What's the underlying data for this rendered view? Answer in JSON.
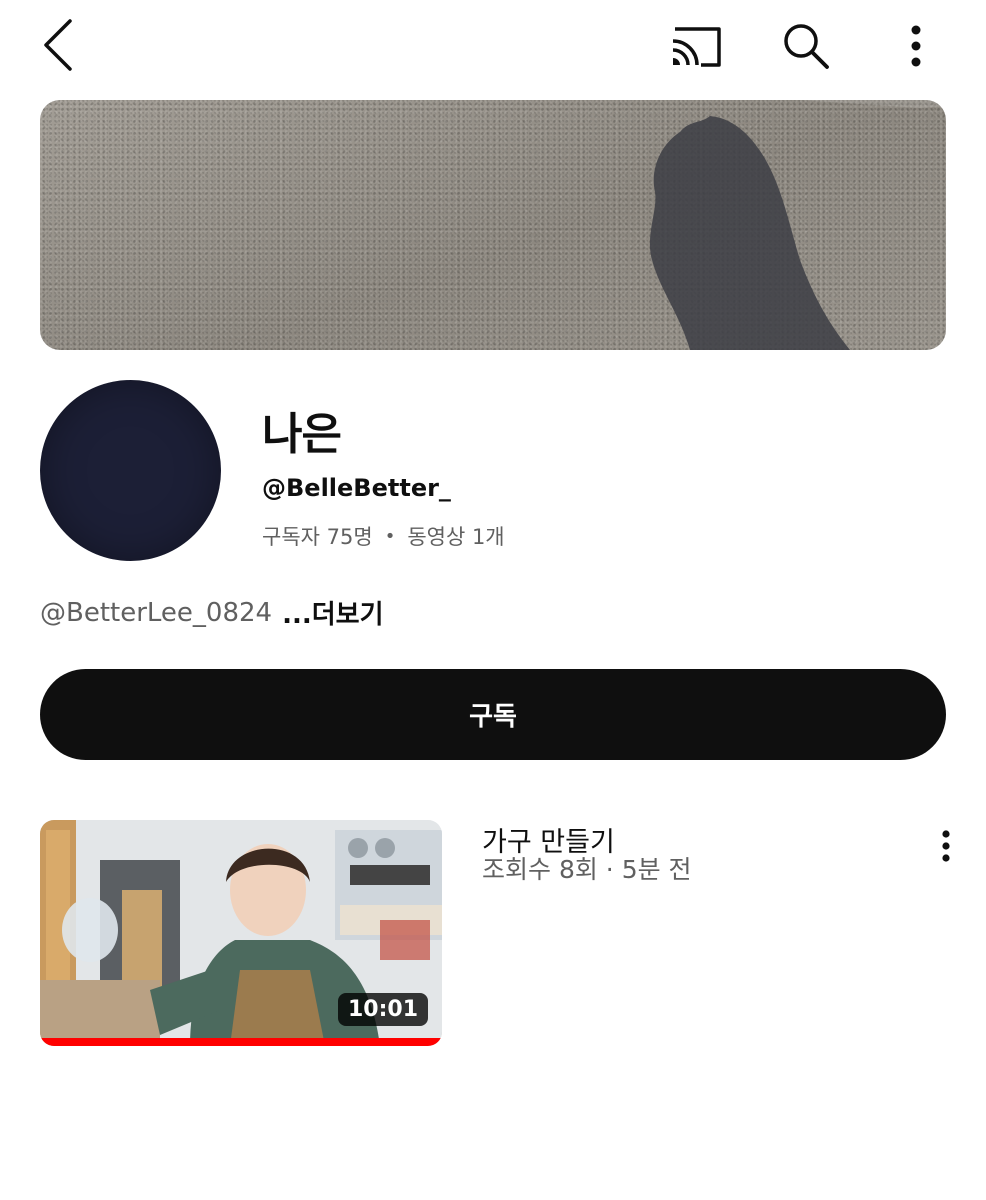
{
  "header": {
    "back_icon": "chevron-left-icon",
    "cast_icon": "cast-icon",
    "search_icon": "search-icon",
    "more_icon": "more-vertical-icon"
  },
  "channel": {
    "name": "나은",
    "handle": "@BelleBetter_",
    "subscribers": "구독자 75명",
    "separator": "•",
    "videos": "동영상 1개",
    "description": "@BetterLee_0824",
    "more_label": "...더보기",
    "subscribe_label": "구독"
  },
  "videos": [
    {
      "title": "가구 만들기",
      "meta": "조회수 8회 · 5분 전",
      "duration": "10:01",
      "watched_fraction": 1.0
    }
  ],
  "colors": {
    "accent": "#ff0000",
    "subscribe_bg": "#0f0f0f",
    "secondary_text": "#606060",
    "avatar": "#1c1f36"
  }
}
